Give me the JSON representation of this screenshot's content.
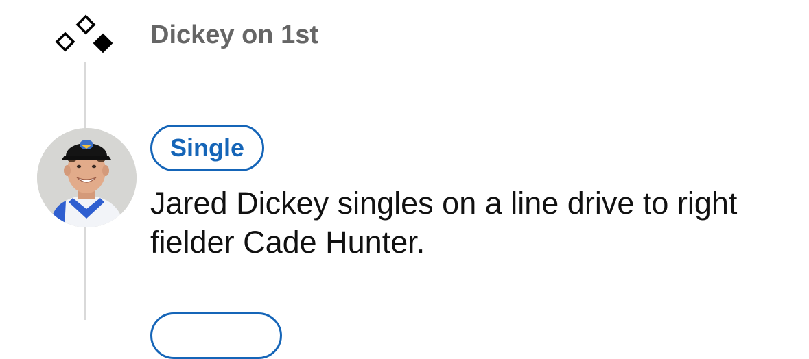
{
  "runner_status": {
    "icon": "bases-icon",
    "occupied_bases": [
      "1st"
    ],
    "text": "Dickey on 1st"
  },
  "play": {
    "badge_label": "Single",
    "description": "Jared Dickey singles on a line drive to right fielder Cade Hunter.",
    "avatar": "player-headshot"
  },
  "colors": {
    "accent": "#1565b8",
    "runner_text": "#666666",
    "body_text": "#111111",
    "timeline": "#d9d9d9"
  }
}
